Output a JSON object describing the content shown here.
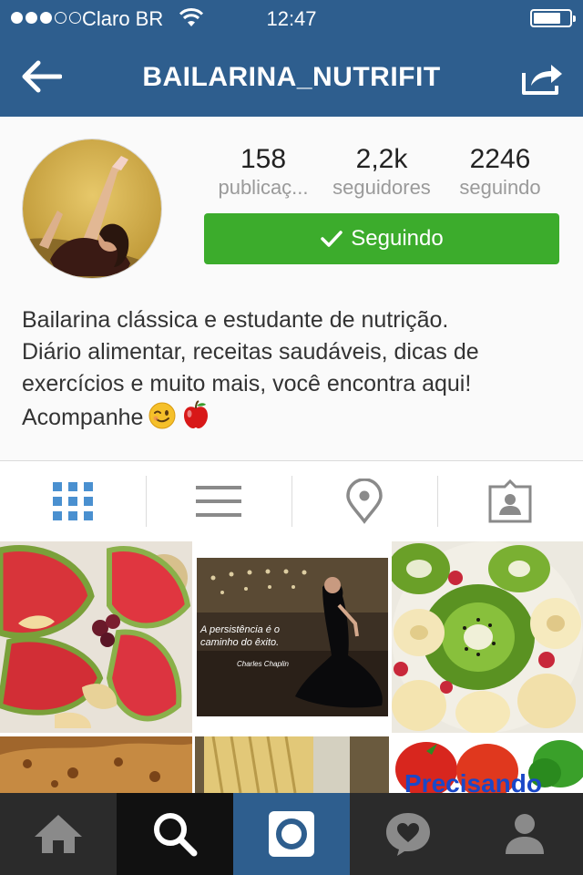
{
  "status_bar": {
    "carrier": "Claro BR",
    "time": "12:47",
    "signal_bars_filled": 3,
    "signal_bars_total": 5,
    "battery_level": 0.7
  },
  "nav": {
    "title": "BAILARINA_NUTRIFIT",
    "back_icon": "back-arrow-icon",
    "share_icon": "share-icon"
  },
  "profile": {
    "stats": [
      {
        "value": "158",
        "label": "publicaç..."
      },
      {
        "value": "2,2k",
        "label": "seguidores"
      },
      {
        "value": "2246",
        "label": "seguindo"
      }
    ],
    "follow_button": "Seguindo",
    "bio_lines": [
      "Bailarina clássica e estudante de nutrição.",
      "Diário alimentar, receitas saudáveis, dicas de",
      "exercícios e muito mais, você encontra aqui!",
      "Acompanhe"
    ],
    "bio_emojis": [
      "winking-face-emoji",
      "red-apple-emoji"
    ]
  },
  "tabs": [
    {
      "icon": "grid-icon",
      "active": true
    },
    {
      "icon": "list-icon",
      "active": false
    },
    {
      "icon": "location-pin-icon",
      "active": false
    },
    {
      "icon": "tagged-photos-icon",
      "active": false
    }
  ],
  "posts": {
    "quote_caption": "A persistência é o caminho do êxito.",
    "quote_author": "Charles Chaplin",
    "partial_post_text": "Precisando"
  },
  "bottom_bar": [
    {
      "icon": "home-icon",
      "active": false
    },
    {
      "icon": "search-icon",
      "active": true
    },
    {
      "icon": "camera-icon",
      "active": false
    },
    {
      "icon": "activity-heart-icon",
      "active": false
    },
    {
      "icon": "profile-icon",
      "active": false
    }
  ],
  "colors": {
    "brand_blue": "#2e5e8e",
    "follow_green": "#3cac2c",
    "tab_active_blue": "#4a90d0"
  }
}
